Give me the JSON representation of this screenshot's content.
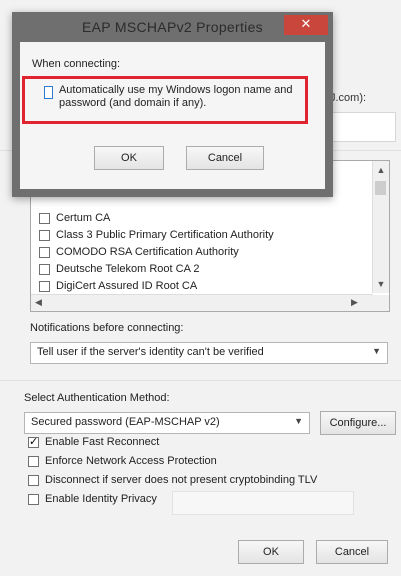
{
  "background": {
    "right_text_fragment": "J.com):"
  },
  "cert_list": {
    "items": [
      {
        "label": "Certum CA",
        "checked": false
      },
      {
        "label": "Class 3 Public Primary Certification Authority",
        "checked": false
      },
      {
        "label": "COMODO RSA Certification Authority",
        "checked": false
      },
      {
        "label": "Deutsche Telekom Root CA 2",
        "checked": false
      },
      {
        "label": "DigiCert Assured ID Root CA",
        "checked": false
      }
    ]
  },
  "notifications": {
    "label": "Notifications before connecting:",
    "selected": "Tell user if the server's identity can't be verified"
  },
  "auth": {
    "label": "Select Authentication Method:",
    "selected": "Secured password (EAP-MSCHAP v2)",
    "configure_label": "Configure..."
  },
  "options": [
    {
      "label": "Enable Fast Reconnect",
      "checked": true
    },
    {
      "label": "Enforce Network Access Protection",
      "checked": false
    },
    {
      "label": "Disconnect if server does not present cryptobinding TLV",
      "checked": false
    },
    {
      "label": "Enable Identity Privacy",
      "checked": false
    }
  ],
  "footer": {
    "ok_label": "OK",
    "cancel_label": "Cancel"
  },
  "dialog": {
    "title": "EAP MSCHAPv2 Properties",
    "close_glyph": "✕",
    "section_label": "When connecting:",
    "checkbox_label": "Automatically use my Windows logon name and password (and domain if any).",
    "checkbox_checked": false,
    "ok_label": "OK",
    "cancel_label": "Cancel"
  },
  "colors": {
    "highlight": "#e0232e",
    "close_button": "#c9463d",
    "dialog_frame": "#6f6f6f"
  }
}
